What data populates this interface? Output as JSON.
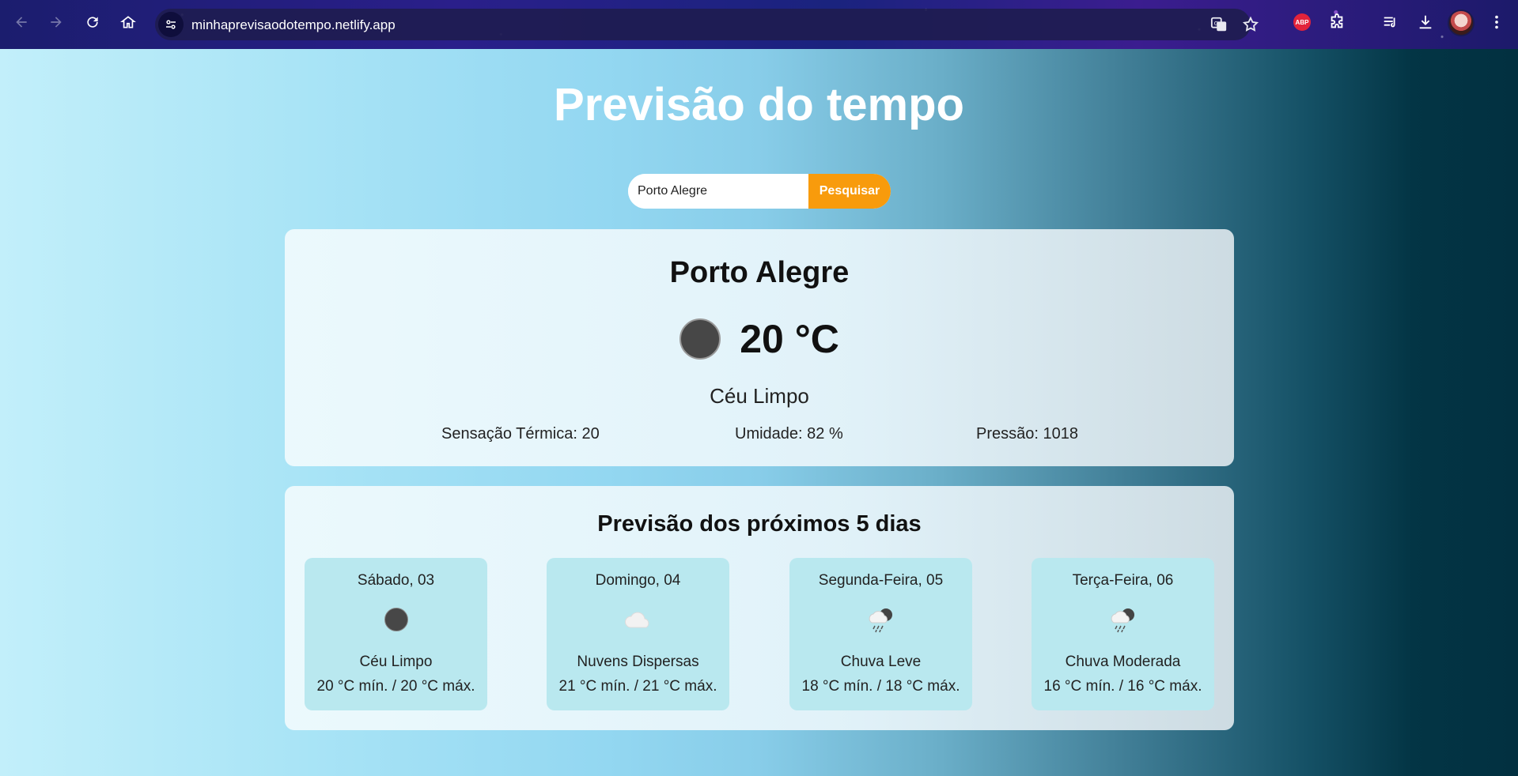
{
  "browser": {
    "url": "minhaprevisaodotempo.netlify.app",
    "extensions": [
      "translate-icon",
      "bookmark-star-icon",
      "adblock-plus-icon",
      "extensions-puzzle-icon",
      "media-queue-icon",
      "download-icon",
      "profile-avatar",
      "menu-dots-icon"
    ],
    "abp_label": "ABP"
  },
  "page": {
    "title": "Previsão do tempo",
    "search": {
      "value": "Porto Alegre",
      "button_label": "Pesquisar"
    }
  },
  "current": {
    "city": "Porto Alegre",
    "temperature": "20 °C",
    "description": "Céu Limpo",
    "feels_like": "Sensação Térmica: 20",
    "humidity": "Umidade: 82 %",
    "pressure": "Pressão: 1018"
  },
  "forecast": {
    "title": "Previsão dos próximos 5 dias",
    "days": [
      {
        "date": "Sábado, 03",
        "icon": "clear-sky-icon",
        "description": "Céu Limpo",
        "temps": "20 °C mín. / 20 °C máx."
      },
      {
        "date": "Domingo, 04",
        "icon": "scattered-clouds-icon",
        "description": "Nuvens Dispersas",
        "temps": "21 °C mín. / 21 °C máx."
      },
      {
        "date": "Segunda-Feira, 05",
        "icon": "rain-night-icon",
        "description": "Chuva Leve",
        "temps": "18 °C mín. / 18 °C máx."
      },
      {
        "date": "Terça-Feira, 06",
        "icon": "rain-night-icon",
        "description": "Chuva Moderada",
        "temps": "16 °C mín. / 16 °C máx."
      }
    ]
  },
  "colors": {
    "search_button": "#f89b0c",
    "day_card": "#b9e8ef",
    "title_text": "#ffffff"
  }
}
